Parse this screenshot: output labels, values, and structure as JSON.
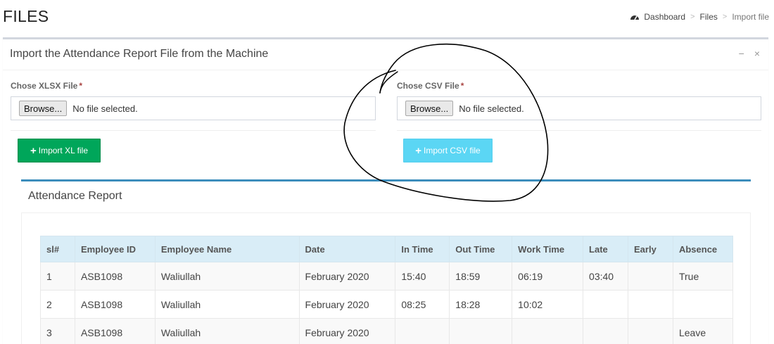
{
  "header": {
    "title": "FILES",
    "breadcrumb": [
      "Dashboard",
      "Files",
      "Import file"
    ]
  },
  "box": {
    "title": "Import the Attendance Report File from the Machine",
    "tools": {
      "collapse": "−",
      "remove": "×"
    },
    "xlsx": {
      "label": "Chose XLSX File",
      "required": "*",
      "browse": "Browse...",
      "status": "No file selected.",
      "button": "Import XL file"
    },
    "csv": {
      "label": "Chose CSV File",
      "required": "*",
      "browse": "Browse...",
      "status": "No file selected.",
      "button": "Import CSV file"
    }
  },
  "report": {
    "title": "Attendance Report",
    "columns": [
      "sl#",
      "Employee ID",
      "Employee Name",
      "Date",
      "In Time",
      "Out Time",
      "Work Time",
      "Late",
      "Early",
      "Absence"
    ],
    "rows": [
      [
        "1",
        "ASB1098",
        "Waliullah",
        "February 2020",
        "15:40",
        "18:59",
        "06:19",
        "03:40",
        "",
        "True"
      ],
      [
        "2",
        "ASB1098",
        "Waliullah",
        "February 2020",
        "08:25",
        "18:28",
        "10:02",
        "",
        "",
        ""
      ],
      [
        "3",
        "ASB1098",
        "Waliullah",
        "February 2020",
        "",
        "",
        "",
        "",
        "",
        "Leave"
      ]
    ]
  },
  "colors": {
    "green": "#00a65a",
    "cyan": "#5bd6f4",
    "header_blue": "#d9edf7",
    "accent_blue": "#3c8dbc"
  },
  "icons": {
    "breadcrumb": "dashboard-icon",
    "button": "plus-icon"
  }
}
